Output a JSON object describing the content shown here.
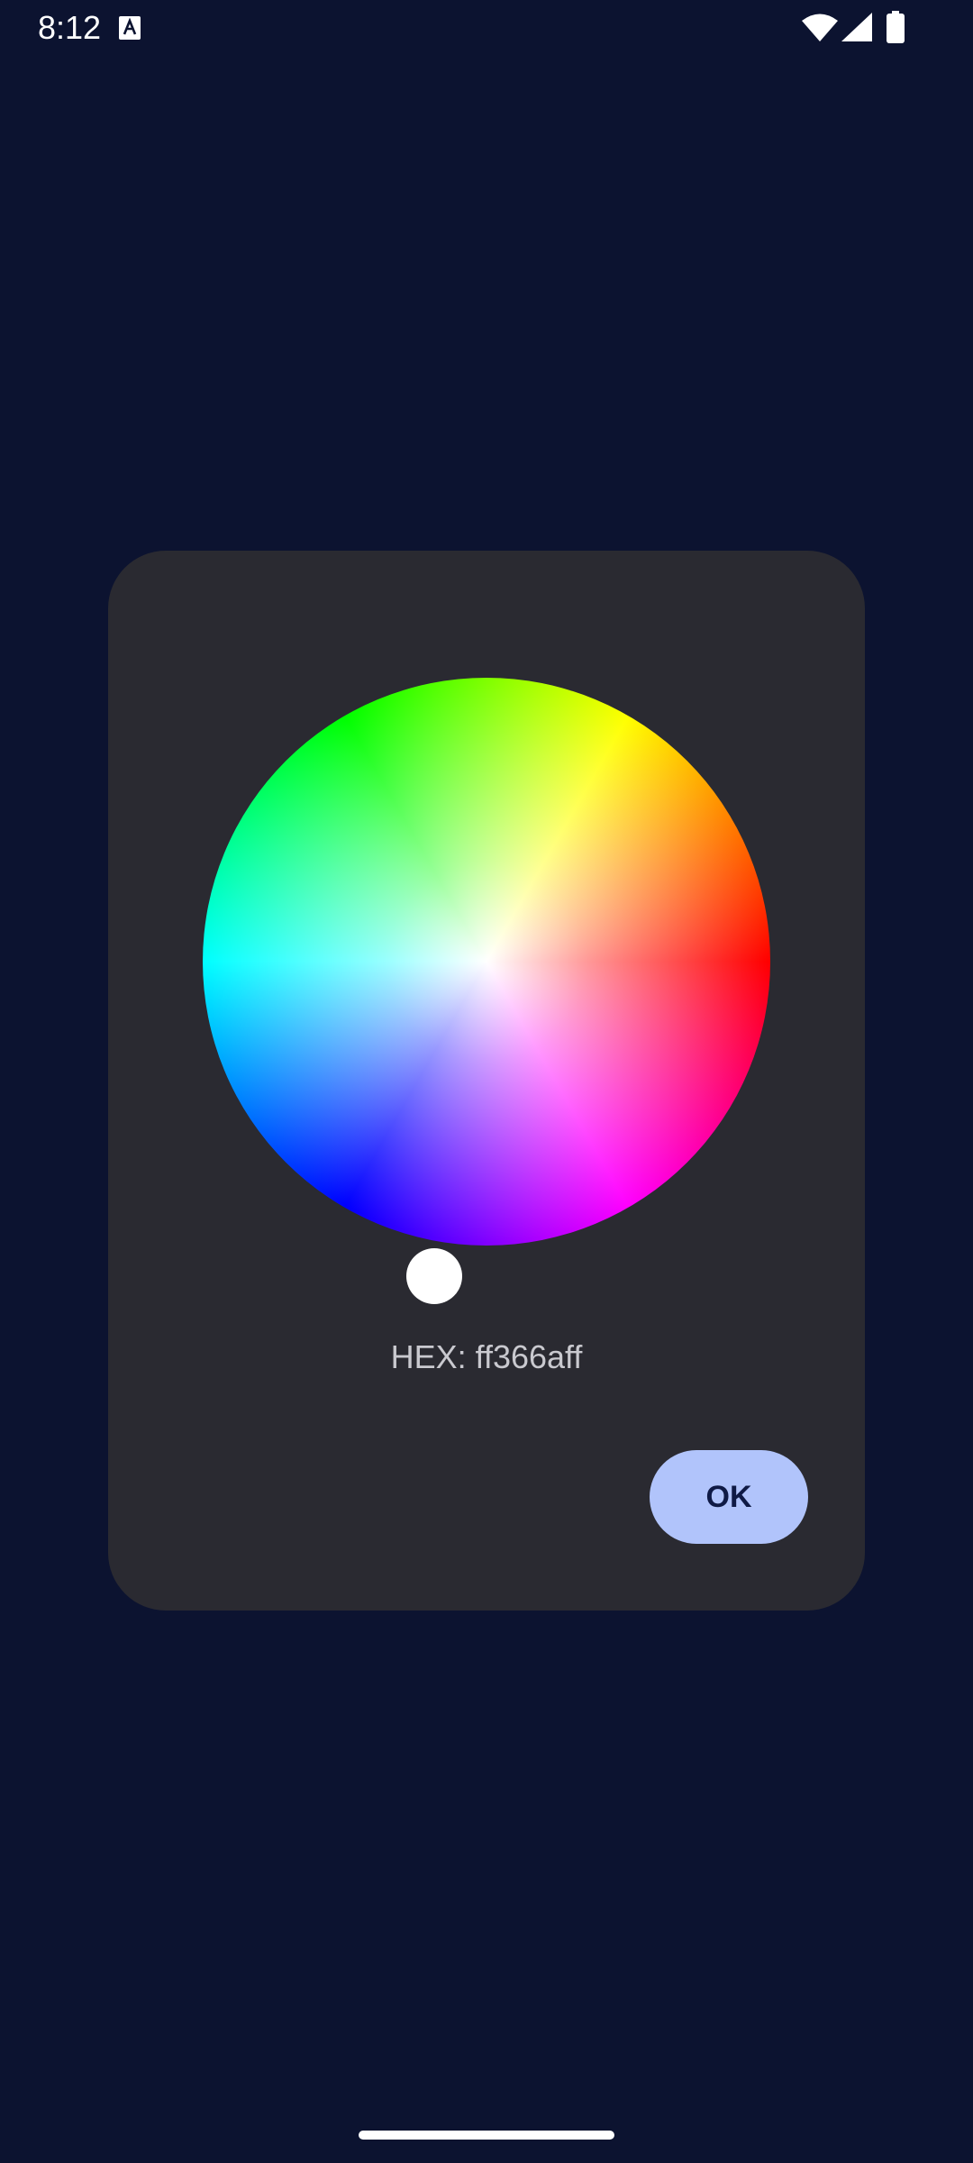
{
  "status_bar": {
    "time": "8:12",
    "icons": [
      "a-icon",
      "wifi-icon",
      "signal-icon",
      "battery-icon"
    ]
  },
  "dialog": {
    "hex_label": "HEX: ff366aff",
    "ok_label": "OK",
    "selected_color": "#366aff"
  },
  "colors": {
    "background": "#0c1330",
    "dialog_background": "#2a2a31",
    "button_background": "#b1c4fb",
    "button_text": "#0f1a45"
  }
}
